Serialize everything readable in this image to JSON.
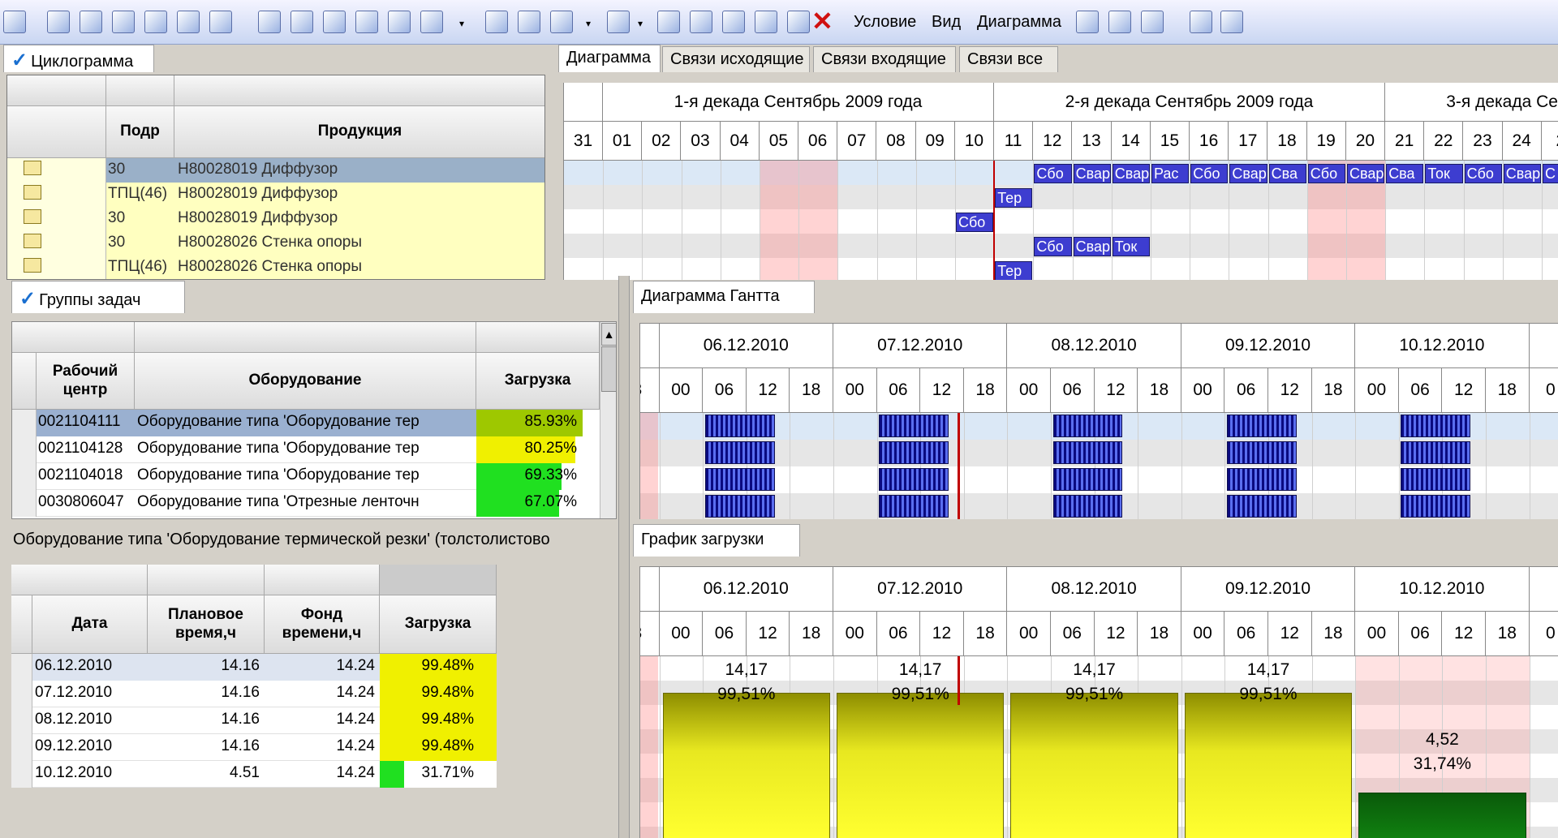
{
  "toolbar": {
    "items": [
      "Условие",
      "Вид",
      "Диаграмма"
    ]
  },
  "top_left": {
    "tab": "Циклограмма",
    "columns": [
      "Подр",
      "Продукция"
    ],
    "rows": [
      {
        "podr": "30",
        "product": "Н80028019 Диффузор"
      },
      {
        "podr": "ТПЦ(46)",
        "product": "Н80028019 Диффузор"
      },
      {
        "podr": "30",
        "product": "Н80028019 Диффузор"
      },
      {
        "podr": "30",
        "product": "Н80028026 Стенка опоры"
      },
      {
        "podr": "ТПЦ(46)",
        "product": "Н80028026 Стенка опоры"
      }
    ]
  },
  "top_right": {
    "tabs": [
      "Диаграмма",
      "Связи исходящие",
      "Связи входящие",
      "Связи все"
    ],
    "decades": [
      "1-я декада Сентябрь 2009 года",
      "2-я декада Сентябрь 2009 года",
      "3-я декада Се"
    ],
    "days": [
      "31",
      "01",
      "02",
      "03",
      "04",
      "05",
      "06",
      "07",
      "08",
      "09",
      "10",
      "11",
      "12",
      "13",
      "14",
      "15",
      "16",
      "17",
      "18",
      "19",
      "20",
      "21",
      "22",
      "23",
      "24",
      "2"
    ],
    "row1": [
      "Сбо",
      "Свар",
      "Свар",
      "Рас",
      "Сбо",
      "Свар",
      "Сва",
      "Сбо",
      "Свар",
      "Сва",
      "Ток",
      "Сбо",
      "Свар",
      "С"
    ],
    "row2": [
      "Тер"
    ],
    "row3": [
      "Сбо"
    ],
    "row4": [
      "Сбо",
      "Свар",
      "Ток"
    ],
    "row5": [
      "Тер"
    ]
  },
  "groups": {
    "tab": "Группы задач",
    "columns": [
      "Рабочий центр",
      "Оборудование",
      "Загрузка"
    ],
    "rows": [
      {
        "wc": "0021104111",
        "eq": "Оборудование типа 'Оборудование тер",
        "load": "85.93%",
        "color": "#9ec800",
        "pct": 85.93
      },
      {
        "wc": "0021104128",
        "eq": "Оборудование типа 'Оборудование тер",
        "load": "80.25%",
        "color": "#f0f000",
        "pct": 80.25
      },
      {
        "wc": "0021104018",
        "eq": "Оборудование типа 'Оборудование тер",
        "load": "69.33%",
        "color": "#20e020",
        "pct": 69.33
      },
      {
        "wc": "0030806047",
        "eq": "Оборудование типа 'Отрезные ленточн",
        "load": "67.07%",
        "color": "#20e020",
        "pct": 67.07
      }
    ]
  },
  "gantt": {
    "tab": "Диаграмма Гантта",
    "dates": [
      "06.12.2010",
      "07.12.2010",
      "08.12.2010",
      "09.12.2010",
      "10.12.2010"
    ],
    "hours": [
      "3",
      "00",
      "06",
      "12",
      "18",
      "00",
      "06",
      "12",
      "18",
      "00",
      "06",
      "12",
      "18",
      "00",
      "06",
      "12",
      "18",
      "00",
      "06",
      "12",
      "18",
      "0"
    ]
  },
  "detail": {
    "title": "Оборудование типа 'Оборудование термической резки' (толстолистово",
    "columns": [
      "Дата",
      "Плановое время,ч",
      "Фонд времени,ч",
      "Загрузка"
    ],
    "rows": [
      {
        "date": "06.12.2010",
        "plan": "14.16",
        "fund": "14.24",
        "load": "99.48%"
      },
      {
        "date": "07.12.2010",
        "plan": "14.16",
        "fund": "14.24",
        "load": "99.48%"
      },
      {
        "date": "08.12.2010",
        "plan": "14.16",
        "fund": "14.24",
        "load": "99.48%"
      },
      {
        "date": "09.12.2010",
        "plan": "14.16",
        "fund": "14.24",
        "load": "99.48%"
      },
      {
        "date": "10.12.2010",
        "plan": "4.51",
        "fund": "14.24",
        "load": "31.71%"
      }
    ]
  },
  "load_chart": {
    "tab": "График загрузки",
    "dates": [
      "06.12.2010",
      "07.12.2010",
      "08.12.2010",
      "09.12.2010",
      "10.12.2010"
    ],
    "hours": [
      "3",
      "00",
      "06",
      "12",
      "18",
      "00",
      "06",
      "12",
      "18",
      "00",
      "06",
      "12",
      "18",
      "00",
      "06",
      "12",
      "18",
      "00",
      "06",
      "12",
      "18",
      "0"
    ],
    "bars": [
      {
        "hours": "14,17",
        "pct": "99,51%"
      },
      {
        "hours": "14,17",
        "pct": "99,51%"
      },
      {
        "hours": "14,17",
        "pct": "99,51%"
      },
      {
        "hours": "14,17",
        "pct": "99,51%"
      },
      {
        "hours": "4,52",
        "pct": "31,74%"
      }
    ]
  }
}
